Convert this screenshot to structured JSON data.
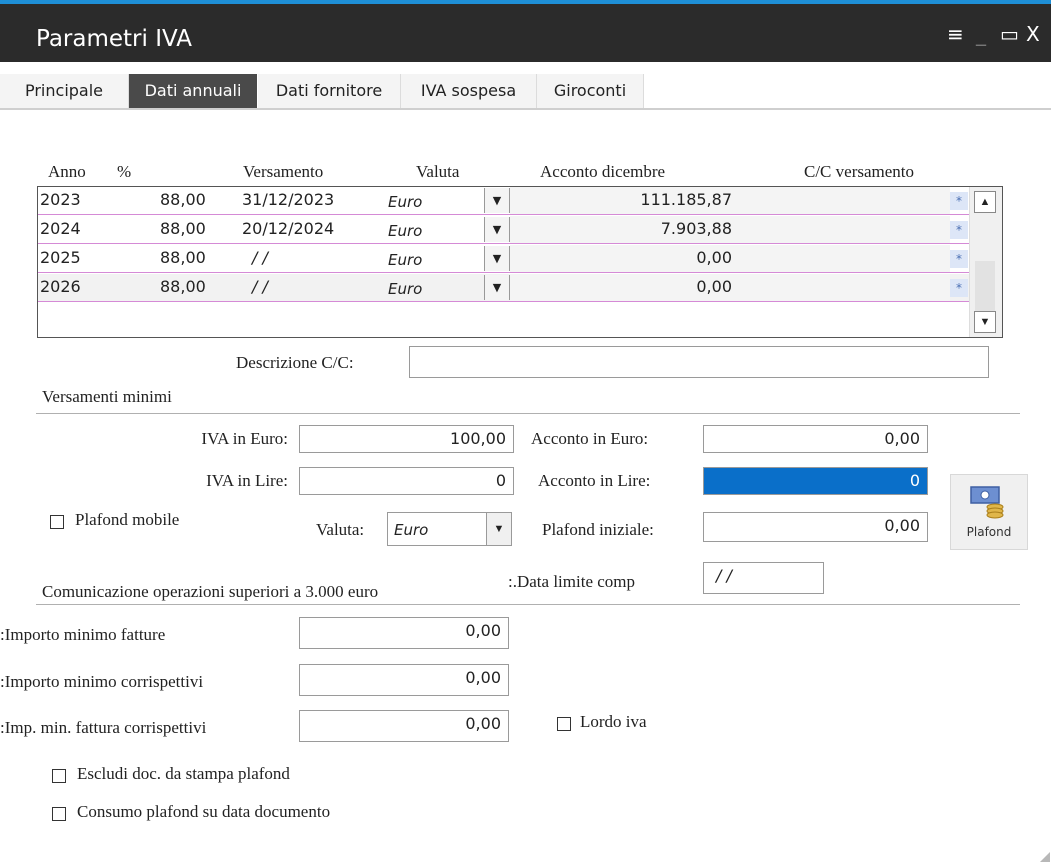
{
  "window": {
    "title": "Parametri IVA",
    "controls": {
      "menu": "≡",
      "minimize": "_",
      "maximize": "▭",
      "close": "X"
    }
  },
  "tabs": [
    {
      "label": "Principale",
      "active": false
    },
    {
      "label": "Dati annuali",
      "active": true
    },
    {
      "label": "Dati fornitore",
      "active": false
    },
    {
      "label": "IVA sospesa",
      "active": false
    },
    {
      "label": "Giroconti",
      "active": false
    }
  ],
  "grid": {
    "headers": {
      "anno": "Anno",
      "perc": "%",
      "versamento": "Versamento",
      "valuta": "Valuta",
      "acconto": "Acconto dicembre",
      "cc": "C/C versamento"
    },
    "rows": [
      {
        "anno": "2023",
        "perc": "88,00",
        "versamento": "31/12/2023",
        "valuta": "Euro",
        "acconto": "111.185,87"
      },
      {
        "anno": "2024",
        "perc": "88,00",
        "versamento": "20/12/2024",
        "valuta": "Euro",
        "acconto": "7.903,88"
      },
      {
        "anno": "2025",
        "perc": "88,00",
        "versamento": "/ /",
        "valuta": "Euro",
        "acconto": "0,00"
      },
      {
        "anno": "2026",
        "perc": "88,00",
        "versamento": "/ /",
        "valuta": "Euro",
        "acconto": "0,00"
      }
    ],
    "star_glyph": "*"
  },
  "descrizione_cc": {
    "label": "Descrizione C/C:",
    "value": ""
  },
  "versamenti_minimi": {
    "section": "Versamenti minimi",
    "iva_euro": {
      "label": "IVA in Euro:",
      "value": "100,00"
    },
    "iva_lire": {
      "label": "IVA in Lire:",
      "value": "0"
    },
    "acconto_euro": {
      "label": "Acconto in Euro:",
      "value": "0,00"
    },
    "acconto_lire": {
      "label": "Acconto in Lire:",
      "value": "0"
    },
    "plafond_mobile": {
      "label": "Plafond mobile",
      "checked": false
    },
    "valuta": {
      "label": "Valuta:",
      "value": "Euro"
    },
    "plafond_iniziale": {
      "label": "Plafond iniziale:",
      "value": "0,00"
    },
    "plafond_button": "Plafond"
  },
  "comunicazione": {
    "section": "Comunicazione operazioni superiori a 3.000 euro",
    "data_limite": {
      "label": "Data limite comp.:",
      "value": "/ /"
    },
    "importo_fatture": {
      "label": "Importo minimo fatture:",
      "value": "0,00"
    },
    "importo_corrispettivi": {
      "label": "Importo minimo corrispettivi:",
      "value": "0,00"
    },
    "imp_fattura_corr": {
      "label": "Imp. min. fattura corrispettivi:",
      "value": "0,00"
    },
    "lordo_iva": {
      "label": "Lordo iva",
      "checked": false
    }
  },
  "opzioni": {
    "escludi": {
      "label": "Escludi doc. da stampa plafond",
      "checked": false
    },
    "consumo": {
      "label": "Consumo plafond su data documento",
      "checked": false
    }
  },
  "colors": {
    "accent": "#1e8fd6",
    "titlebar": "#2b2b2b",
    "selection": "#0a6fc9",
    "row_line": "#d58ad6"
  }
}
